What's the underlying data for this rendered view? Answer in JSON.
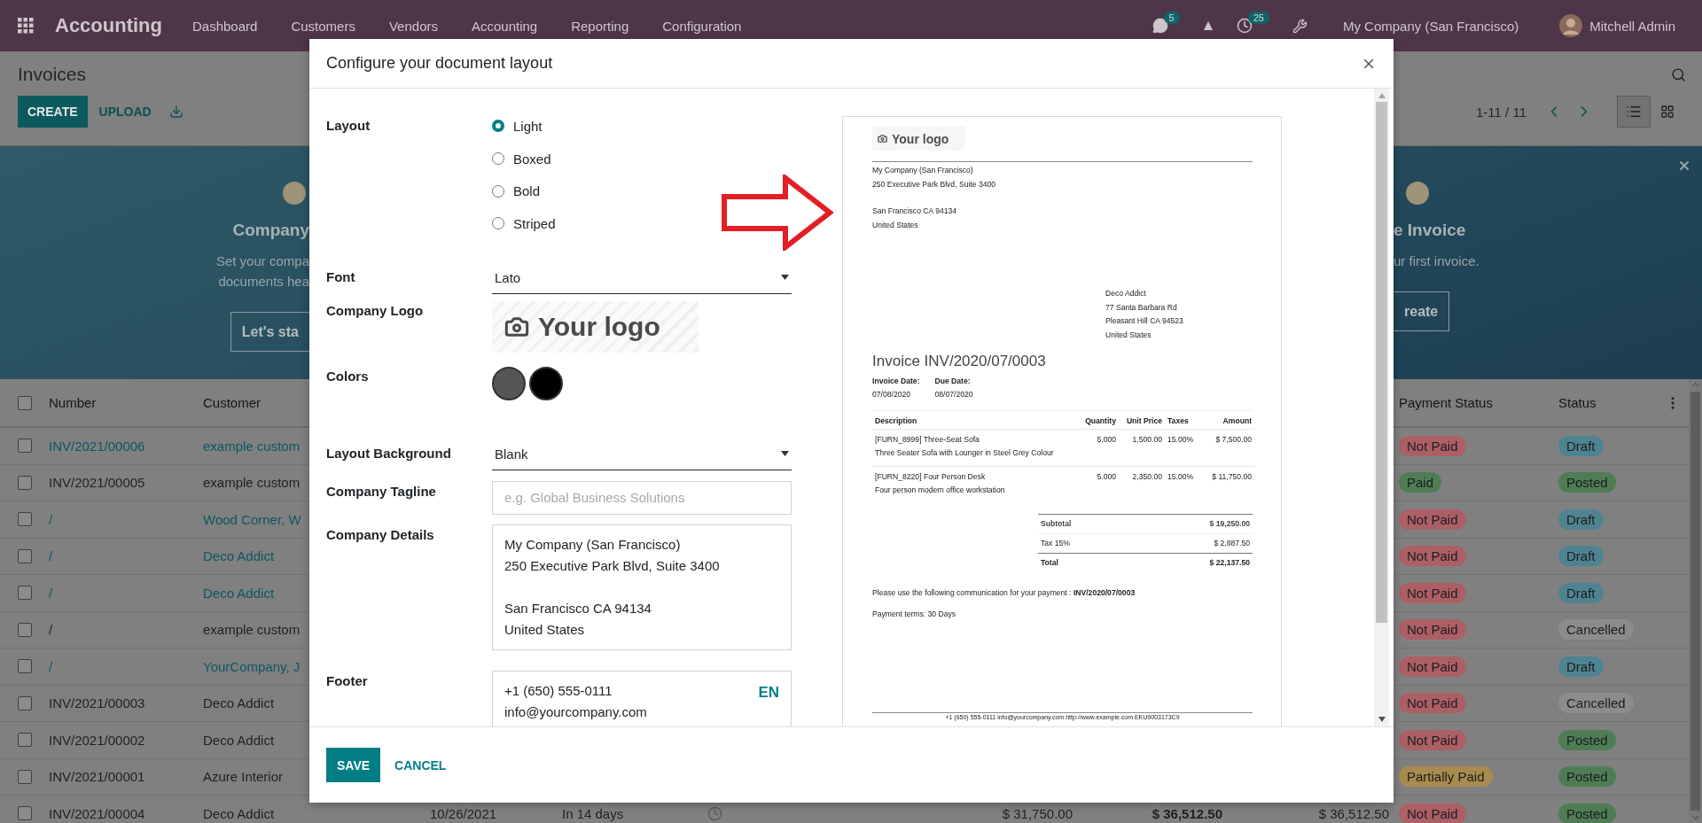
{
  "navbar": {
    "app_name": "Accounting",
    "menu": [
      "Dashboard",
      "Customers",
      "Vendors",
      "Accounting",
      "Reporting",
      "Configuration"
    ],
    "messages_badge": "5",
    "activities_badge": "25",
    "company": "My Company (San Francisco)",
    "user": "Mitchell Admin"
  },
  "control_panel": {
    "breadcrumb": "Invoices",
    "buttons": [
      {
        "label": "CREATE",
        "kind": "primary"
      },
      {
        "label": "UPLOAD",
        "kind": "link"
      }
    ],
    "pager": "1-11 / 11",
    "views": [
      {
        "kind": "list",
        "selected": true
      },
      {
        "kind": "kanban",
        "selected": false
      }
    ]
  },
  "banner": {
    "left": {
      "title": "Company",
      "lines": [
        "Set your compa",
        "documents hea"
      ],
      "button": "Let's sta"
    },
    "right": {
      "title": "e Invoice",
      "lines": [
        "ur first invoice."
      ],
      "button": "reate"
    }
  },
  "table": {
    "select_all_checked": false,
    "columns": [
      "Number",
      "Customer",
      "Payment Status",
      "Status"
    ],
    "rows": [
      {
        "checked": false,
        "number": "INV/2021/00006",
        "customer": "example custom",
        "highlighted": true,
        "payment": {
          "label": "Not Paid",
          "color": "#ad5f66"
        },
        "status": {
          "label": "Draft",
          "color": "#4f8391"
        }
      },
      {
        "checked": false,
        "number": "INV/2021/00005",
        "customer": "example custom",
        "highlighted": false,
        "payment": {
          "label": "Paid",
          "color": "#4e7d55"
        },
        "status": {
          "label": "Posted",
          "color": "#4e7d55"
        }
      },
      {
        "checked": false,
        "number": "/",
        "customer": "Wood Corner, W",
        "highlighted": true,
        "payment": {
          "label": "Not Paid",
          "color": "#ad5f66"
        },
        "status": {
          "label": "Draft",
          "color": "#4f8391"
        }
      },
      {
        "checked": false,
        "number": "/",
        "customer": "Deco Addict",
        "highlighted": true,
        "payment": {
          "label": "Not Paid",
          "color": "#ad5f66"
        },
        "status": {
          "label": "Draft",
          "color": "#4f8391"
        }
      },
      {
        "checked": false,
        "number": "/",
        "customer": "Deco Addict",
        "highlighted": true,
        "payment": {
          "label": "Not Paid",
          "color": "#ad5f66"
        },
        "status": {
          "label": "Draft",
          "color": "#4f8391"
        }
      },
      {
        "checked": false,
        "number": "/",
        "customer": "example custom",
        "highlighted": false,
        "payment": {
          "label": "Not Paid",
          "color": "#ad5f66"
        },
        "status": {
          "label": "Cancelled",
          "color": "#8c8c8c"
        }
      },
      {
        "checked": false,
        "number": "/",
        "customer": "YourCompany, J",
        "highlighted": true,
        "payment": {
          "label": "Not Paid",
          "color": "#ad5f66"
        },
        "status": {
          "label": "Draft",
          "color": "#4f8391"
        }
      },
      {
        "checked": false,
        "number": "INV/2021/00003",
        "customer": "Deco Addict",
        "highlighted": false,
        "payment": {
          "label": "Not Paid",
          "color": "#ad5f66"
        },
        "status": {
          "label": "Cancelled",
          "color": "#8c8c8c"
        }
      },
      {
        "checked": false,
        "number": "INV/2021/00002",
        "customer": "Deco Addict",
        "highlighted": false,
        "payment": {
          "label": "Not Paid",
          "color": "#ad5f66"
        },
        "status": {
          "label": "Posted",
          "color": "#4e7d55"
        }
      },
      {
        "checked": false,
        "number": "INV/2021/00001",
        "customer": "Azure Interior",
        "highlighted": false,
        "payment": {
          "label": "Partially Paid",
          "color": "#a88c4f"
        },
        "status": {
          "label": "Posted",
          "color": "#4e7d55"
        }
      },
      {
        "checked": false,
        "number": "INV/2021/00004",
        "customer": "Deco Addict",
        "invoice_date": "10/26/2021",
        "due": "In 14 days",
        "untaxed": "$ 31,750.00",
        "total": "$ 36,512.50",
        "amount_due": "$ 36,512.50",
        "highlighted": false,
        "payment": {
          "label": "Not Paid",
          "color": "#ad5f66"
        },
        "status": {
          "label": "Posted",
          "color": "#4e7d55"
        }
      }
    ]
  },
  "dialog": {
    "title": "Configure your document layout",
    "form": {
      "layout": {
        "label": "Layout",
        "options": [
          {
            "label": "Light",
            "selected": true
          },
          {
            "label": "Boxed",
            "selected": false
          },
          {
            "label": "Bold",
            "selected": false
          },
          {
            "label": "Striped",
            "selected": false
          }
        ]
      },
      "font": {
        "label": "Font",
        "value": "Lato"
      },
      "logo": {
        "label": "Company Logo",
        "text": "Your logo"
      },
      "colors": {
        "label": "Colors",
        "swatches": [
          {
            "color": "#555555"
          },
          {
            "color": "#000000"
          }
        ]
      },
      "background": {
        "label": "Layout Background",
        "value": "Blank"
      },
      "tagline": {
        "label": "Company Tagline",
        "placeholder": "e.g. Global Business Solutions"
      },
      "details": {
        "label": "Company Details",
        "paragraphs": [
          [
            "My Company (San Francisco)",
            "250 Executive Park Blvd, Suite 3400"
          ],
          [
            "San Francisco CA 94134",
            "United States"
          ]
        ]
      },
      "footer": {
        "label": "Footer",
        "lines": [
          "+1 (650) 555-0111",
          "info@yourcompany.com"
        ],
        "language": "EN"
      }
    },
    "preview": {
      "logo_text": "Your logo",
      "company_address": [
        [
          "My Company (San Francisco)",
          "250 Executive Park Blvd, Suite 3400"
        ],
        [
          "San Francisco CA 94134",
          "United States"
        ]
      ],
      "customer_address": [
        "Deco Addict",
        "77 Santa Barbara Rd",
        "Pleasant Hill CA 94523",
        "United States"
      ],
      "title": "Invoice INV/2020/07/0003",
      "dates": [
        {
          "label": "Invoice Date:",
          "value": "07/08/2020"
        },
        {
          "label": "Due Date:",
          "value": "08/07/2020"
        }
      ],
      "columns": [
        "Description",
        "Quantity",
        "Unit Price",
        "Taxes",
        "Amount"
      ],
      "lines": [
        {
          "description": "[FURN_8999] Three-Seat Sofa",
          "note": "Three Seater Sofa with Lounger in Steel Grey Colour",
          "quantity": "5.000",
          "unit_price": "1,500.00",
          "taxes": "15.00%",
          "amount": "$ 7,500.00"
        },
        {
          "description": "[FURN_8220] Four Person Desk",
          "note": "Four person modern office workstation",
          "quantity": "5.000",
          "unit_price": "2,350.00",
          "taxes": "15.00%",
          "amount": "$ 11,750.00"
        }
      ],
      "totals": [
        {
          "kind": "subtotal",
          "label": "Subtotal",
          "value": "$ 19,250.00"
        },
        {
          "kind": "tax",
          "label": "Tax 15%",
          "value": "$ 2,887.50"
        },
        {
          "kind": "total",
          "label": "Total",
          "value": "$ 22,137.50"
        }
      ],
      "communication": "Please use the following communication for your payment : **INV/2020/07/0003**",
      "payment_terms": "Payment terms: 30 Days",
      "footer": "+1 (650) 555-0111 info@yourcompany.com http://www.example.com EKU9003173C9"
    },
    "buttons": [
      {
        "label": "SAVE",
        "kind": "primary"
      },
      {
        "label": "CANCEL",
        "kind": "link"
      }
    ]
  }
}
